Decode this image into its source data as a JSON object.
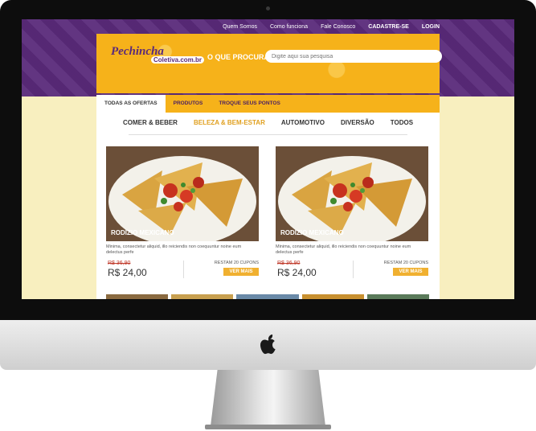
{
  "top_nav": {
    "links": [
      "Quem Somos",
      "Como funciona",
      "Fale Conosco"
    ],
    "register": "CADASTRE-SE",
    "login": "LOGIN"
  },
  "logo": {
    "name": "Pechincha",
    "tagline": "Coletiva",
    "domain": ".com.br"
  },
  "search": {
    "label": "O QUE PROCURA?",
    "placeholder": "Digite aqui sua pesquisa"
  },
  "tabs": [
    "TODAS AS OFERTAS",
    "PRODUTOS",
    "TROQUE SEUS PONTOS"
  ],
  "categories": [
    "COMER & BEBER",
    "BELEZA & BEM-ESTAR",
    "AUTOMOTIVO",
    "DIVERSÃO",
    "TODOS"
  ],
  "cards": [
    {
      "title": "RODIZIO MEXICANO",
      "description": "Minima, consectetur aliquid, illo reiciendis non coequuntur noine eum delectus perfe",
      "old_price": "R$ 36,90",
      "price": "R$ 24,00",
      "coupons": "RESTAM 20 CUPONS",
      "cta": "VER MAIS"
    },
    {
      "title": "RODIZIO MEXICANO",
      "description": "Minima, consectetur aliquid, illo reiciendis non coequuntur noine eum delectus perfe",
      "old_price": "R$ 36,90",
      "price": "R$ 24,00",
      "coupons": "RESTAM 20 CUPONS",
      "cta": "VER MAIS"
    }
  ],
  "colors": {
    "purple": "#5a2a7a",
    "yellow": "#f6b21a",
    "cream": "#f8efbf",
    "button": "#f0b030",
    "old_price": "#c03a2b"
  }
}
